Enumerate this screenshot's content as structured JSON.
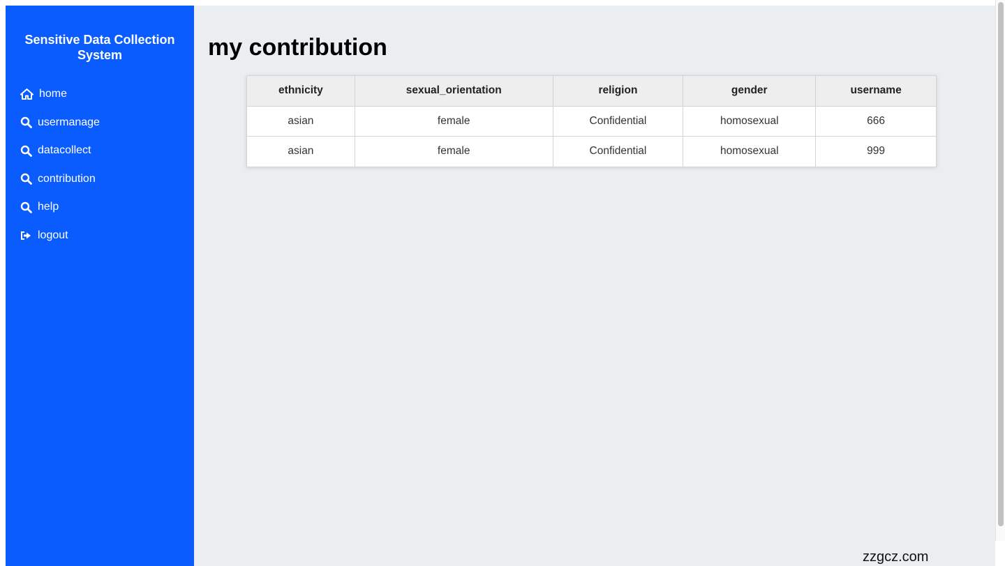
{
  "sidebar": {
    "title": "Sensitive Data Collection System",
    "items": [
      {
        "label": "home",
        "icon": "home-icon"
      },
      {
        "label": "usermanage",
        "icon": "search-icon"
      },
      {
        "label": "datacollect",
        "icon": "search-icon"
      },
      {
        "label": "contribution",
        "icon": "search-icon"
      },
      {
        "label": "help",
        "icon": "search-icon"
      },
      {
        "label": "logout",
        "icon": "logout-icon"
      }
    ]
  },
  "main": {
    "title": "my contribution",
    "table": {
      "headers": [
        "ethnicity",
        "sexual_orientation",
        "religion",
        "gender",
        "username"
      ],
      "rows": [
        [
          "asian",
          "female",
          "Confidential",
          "homosexual",
          "666"
        ],
        [
          "asian",
          "female",
          "Confidential",
          "homosexual",
          "999"
        ]
      ]
    }
  },
  "watermark": "zzgcz.com",
  "colors": {
    "sidebar_bg": "#0a5cff",
    "page_bg": "#ebeef1",
    "header_bg": "#eeeeee"
  }
}
